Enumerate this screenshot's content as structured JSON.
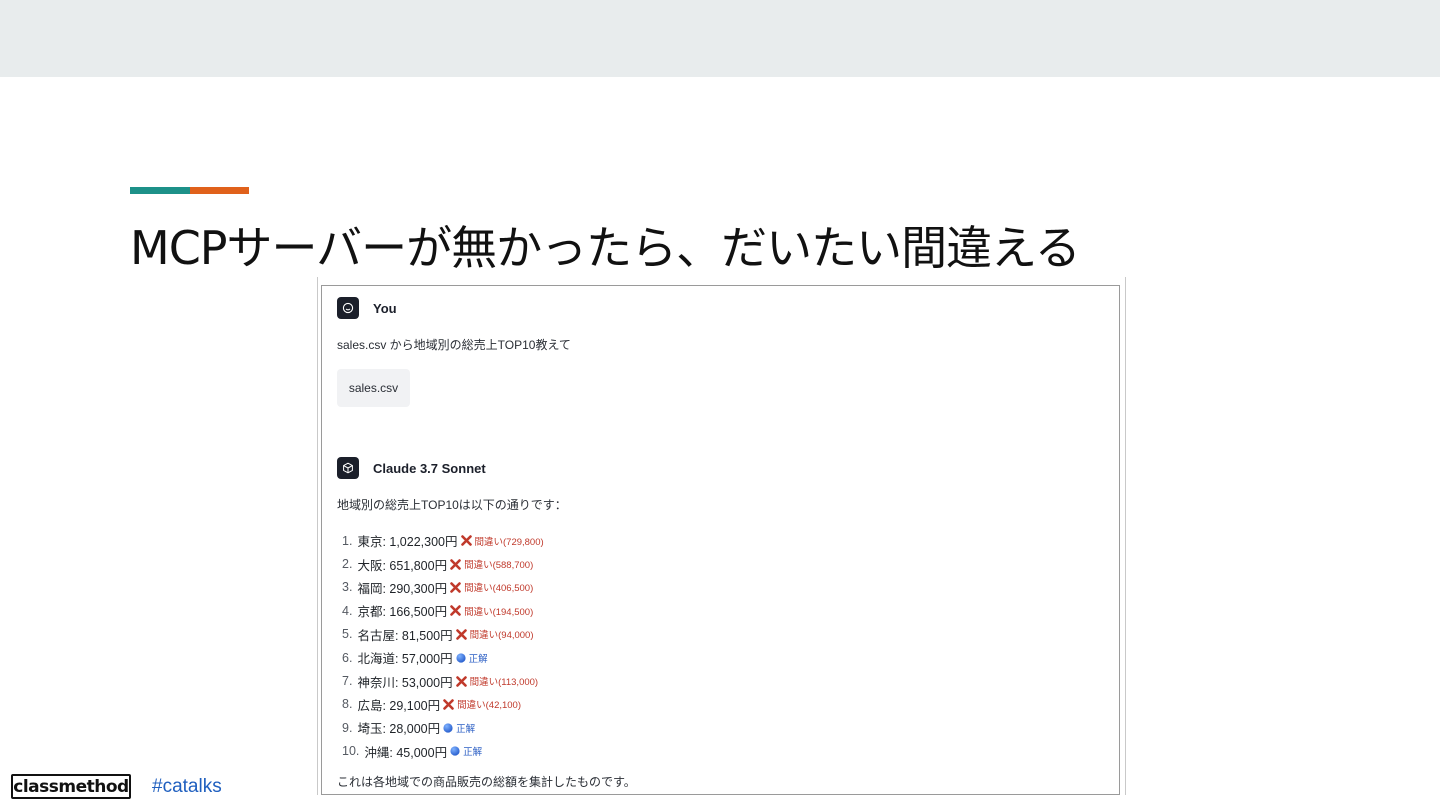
{
  "slide": {
    "title": "MCPサーバーが無かったら、だいたい間違える",
    "accent_colors": [
      "#1d9189",
      "#e0611b"
    ]
  },
  "chat": {
    "user": {
      "name": "You",
      "message": "sales.csv から地域別の総売上TOP10教えて",
      "attachment": "sales.csv"
    },
    "assistant": {
      "name": "Claude 3.7 Sonnet",
      "intro": "地域別の総売上TOP10は以下の通りです：",
      "items": [
        {
          "rank": "1.",
          "text": "東京: 1,022,300円",
          "mark": "cross",
          "note": "間違い(729,800)"
        },
        {
          "rank": "2.",
          "text": "大阪: 651,800円",
          "mark": "cross",
          "note": "間違い(588,700)"
        },
        {
          "rank": "3.",
          "text": "福岡: 290,300円",
          "mark": "cross",
          "note": "間違い(406,500)"
        },
        {
          "rank": "4.",
          "text": "京都: 166,500円",
          "mark": "cross",
          "note": "間違い(194,500)"
        },
        {
          "rank": "5.",
          "text": "名古屋: 81,500円",
          "mark": "cross",
          "note": "間違い(94,000)"
        },
        {
          "rank": "6.",
          "text": "北海道: 57,000円",
          "mark": "circle",
          "note": "正解"
        },
        {
          "rank": "7.",
          "text": "神奈川: 53,000円",
          "mark": "cross",
          "note": "間違い(113,000)"
        },
        {
          "rank": "8.",
          "text": "広島: 29,100円",
          "mark": "cross",
          "note": "間違い(42,100)"
        },
        {
          "rank": "9.",
          "text": "埼玉: 28,000円",
          "mark": "circle",
          "note": "正解"
        },
        {
          "rank": "10.",
          "text": "沖縄: 45,000円",
          "mark": "circle",
          "note": "正解"
        }
      ],
      "summary": "これは各地域での商品販売の総額を集計したものです。"
    },
    "colors": {
      "wrong": "#c0392b",
      "right": "#2c5fc4"
    }
  },
  "footer": {
    "logo": "classmethod",
    "hashtag": "#catalks"
  }
}
